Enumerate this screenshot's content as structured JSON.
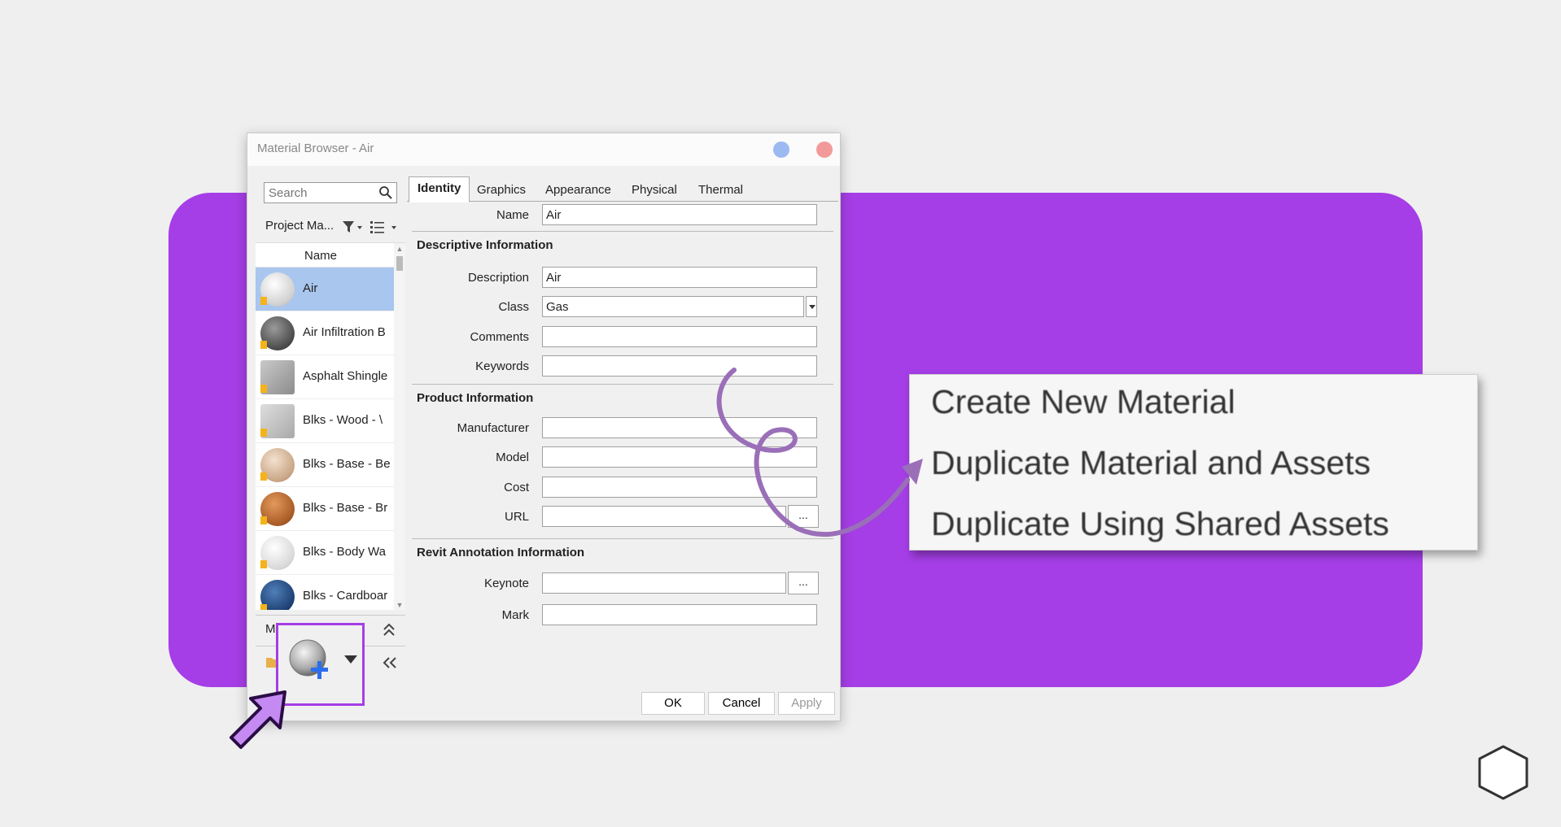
{
  "dialog": {
    "title": "Material Browser - Air",
    "search_placeholder": "Search",
    "library_label": "Project Ma...",
    "list_header": "Name",
    "materials": [
      {
        "name": "Air",
        "selected": true
      },
      {
        "name": "Air Infiltration B"
      },
      {
        "name": "Asphalt Shingle"
      },
      {
        "name": "Blks -  Wood - \\"
      },
      {
        "name": "Blks - Base - Be"
      },
      {
        "name": "Blks - Base - Br"
      },
      {
        "name": "Blks - Body Wa"
      },
      {
        "name": "Blks - Cardboar"
      }
    ],
    "library_bar_label": "M",
    "tabs": [
      "Identity",
      "Graphics",
      "Appearance",
      "Physical",
      "Thermal"
    ],
    "active_tab": "Identity",
    "fields": {
      "name_label": "Name",
      "name_value": "Air",
      "section_descriptive": "Descriptive Information",
      "description_label": "Description",
      "description_value": "Air",
      "class_label": "Class",
      "class_value": "Gas",
      "comments_label": "Comments",
      "comments_value": "",
      "keywords_label": "Keywords",
      "keywords_value": "",
      "section_product": "Product Information",
      "manufacturer_label": "Manufacturer",
      "manufacturer_value": "",
      "model_label": "Model",
      "model_value": "",
      "cost_label": "Cost",
      "cost_value": "",
      "url_label": "URL",
      "url_value": "",
      "section_annotation": "Revit Annotation Information",
      "keynote_label": "Keynote",
      "keynote_value": "",
      "mark_label": "Mark",
      "mark_value": ""
    },
    "ellipsis": "...",
    "buttons": {
      "ok": "OK",
      "cancel": "Cancel",
      "apply": "Apply"
    }
  },
  "context_menu": {
    "items": [
      "Create New Material",
      "Duplicate Material and Assets",
      "Duplicate Using Shared Assets"
    ]
  },
  "colors": {
    "accent": "#a53ee6",
    "selection": "#a9c6ee",
    "arrow_curve": "#9a6fb8"
  }
}
